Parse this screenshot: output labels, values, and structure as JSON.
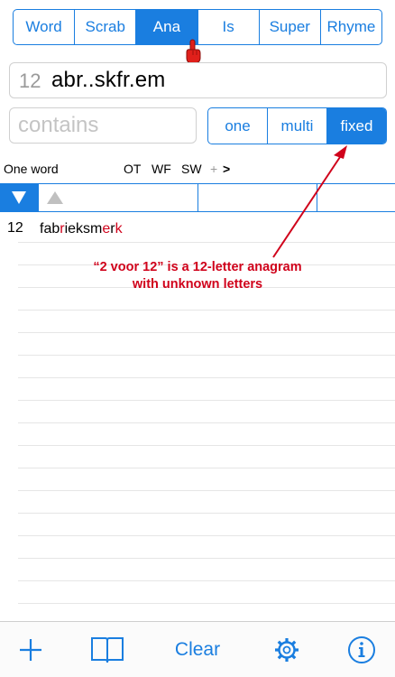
{
  "mode_tabs": [
    "Word",
    "Scrab",
    "Ana",
    "Is",
    "Super",
    "Rhyme"
  ],
  "mode_active": "Ana",
  "pattern": {
    "count": "12",
    "value": "abr..skfr.em"
  },
  "contains": {
    "placeholder": "contains",
    "value": ""
  },
  "match_tabs": [
    "one",
    "multi",
    "fixed"
  ],
  "match_active": "fixed",
  "info_row": {
    "label": "One word",
    "ot": "OT",
    "wf": "WF",
    "sw": "SW",
    "plus": "+",
    "more": ">"
  },
  "results": [
    {
      "count": "12",
      "word_plain": "fabr",
      "word_parts": [
        {
          "text": "fab",
          "hl": false
        },
        {
          "text": "r",
          "hl": true
        },
        {
          "text": "ieksm",
          "hl": false
        },
        {
          "text": "e",
          "hl": true
        },
        {
          "text": "r",
          "hl": false
        },
        {
          "text": "k",
          "hl": true
        }
      ]
    }
  ],
  "annotation": {
    "line1": "“2 voor 12” is a 12-letter anagram",
    "line2": "with unknown letters"
  },
  "toolbar": {
    "add_icon": "plus-icon",
    "book_icon": "book-icon",
    "clear_label": "Clear",
    "settings_icon": "gear-icon",
    "info_icon": "info-icon"
  },
  "colors": {
    "accent": "#1a7ee0",
    "highlight": "#d0021b"
  }
}
